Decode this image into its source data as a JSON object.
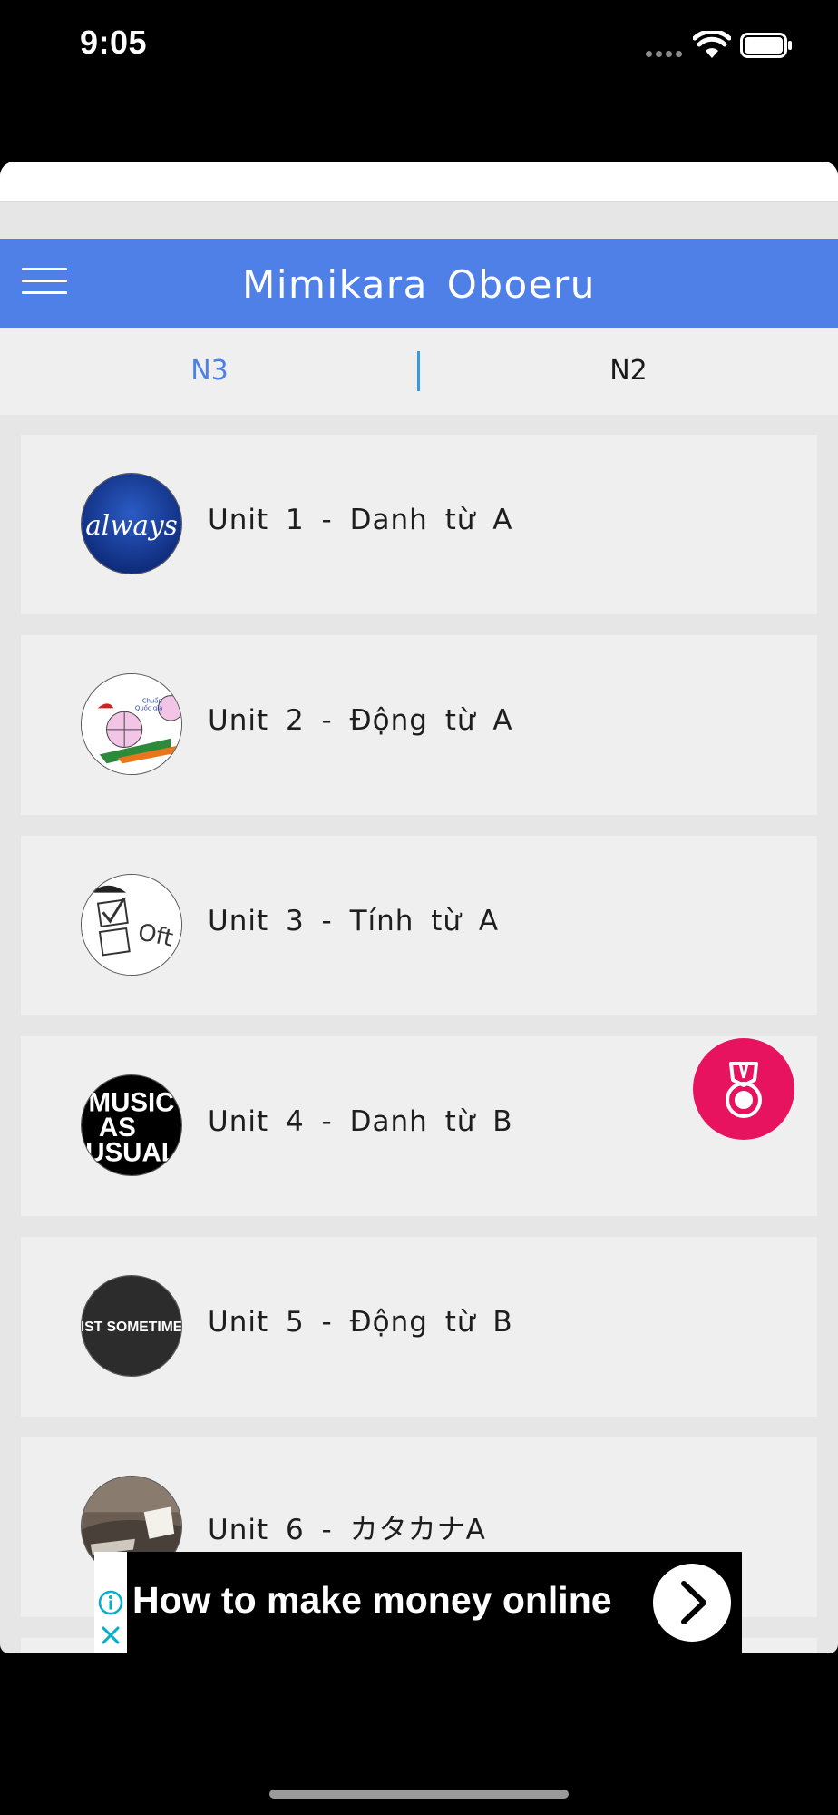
{
  "status_bar": {
    "time": "9:05"
  },
  "header": {
    "title": "Mimikara  Oboeru",
    "menu_icon": "hamburger-menu-icon",
    "color": "#4f80e8"
  },
  "tabs": [
    {
      "label": "N3",
      "active": true
    },
    {
      "label": "N2",
      "active": false
    }
  ],
  "units": [
    {
      "label": "Unit  1  -  Danh  từ  A",
      "thumb": "always-logo"
    },
    {
      "label": "Unit  2  -  Động  từ  A",
      "thumb": "pdca-diagram"
    },
    {
      "label": "Unit  3  -  Tính  từ  A",
      "thumb": "checkbox-often"
    },
    {
      "label": "Unit  4  -  Danh  từ  B",
      "thumb": "music-as-usual"
    },
    {
      "label": "Unit  5  -  Động  từ  B",
      "thumb": "just-sometimes"
    },
    {
      "label": "Unit  6  -  カタカナA",
      "thumb": "landscape-photo"
    }
  ],
  "fab": {
    "icon": "medal-icon",
    "color": "#e8135f"
  },
  "ad": {
    "text": "How to make money online",
    "info_icon": "ad-info-icon",
    "close_icon": "ad-close-icon",
    "arrow_icon": "chevron-right-icon"
  },
  "thumb_texts": {
    "always": "always",
    "pdca_title": "Chuẩn",
    "pdca_sub": "Quốc gia",
    "often": "Oft",
    "music_line1": "MUSIC",
    "music_line2": "AS",
    "music_line3": "USUAL",
    "sometimes": "IST SOMETIME"
  }
}
